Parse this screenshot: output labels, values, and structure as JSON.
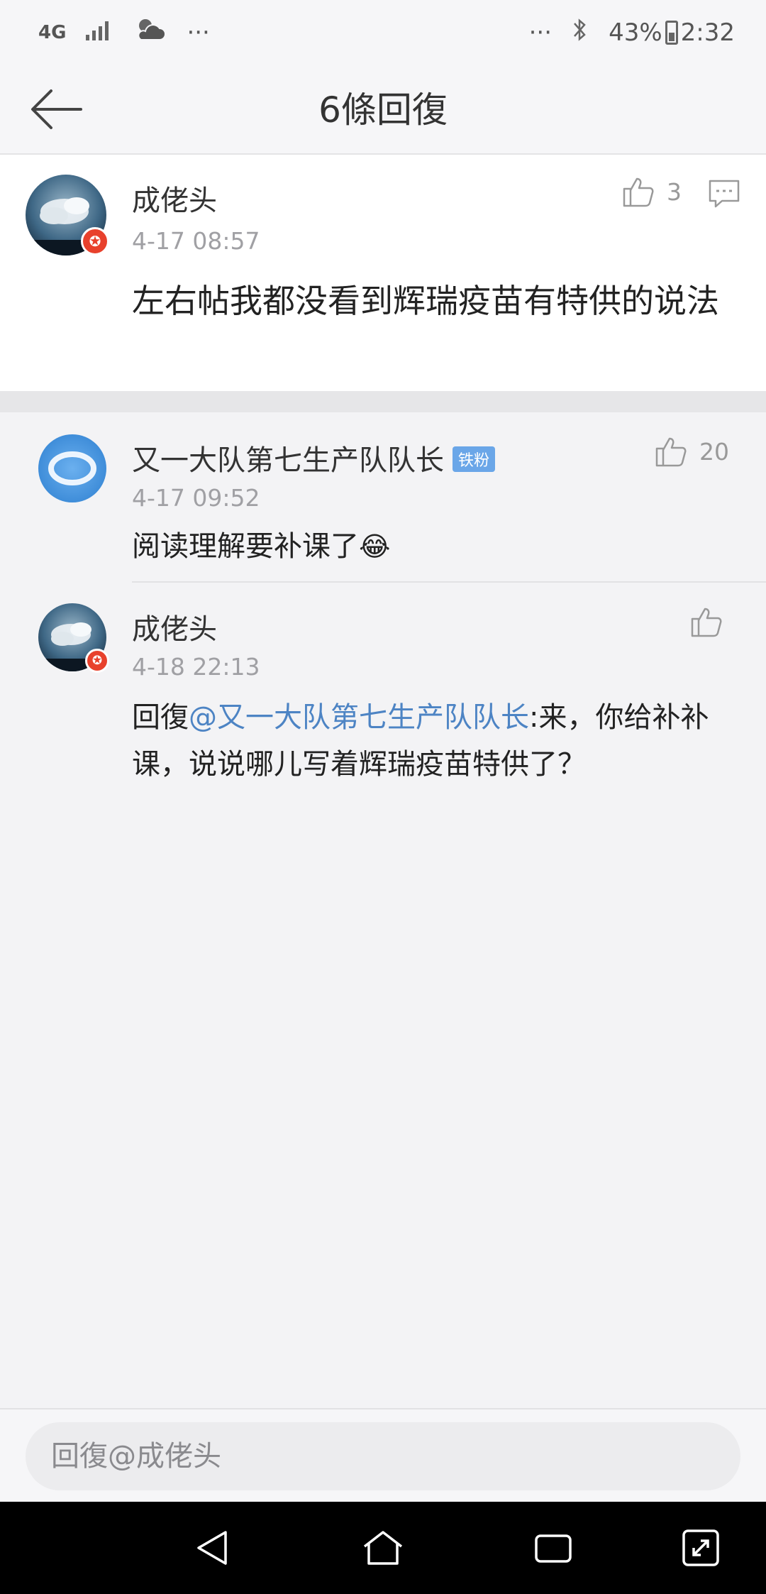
{
  "status_bar": {
    "network": "4G",
    "overflow_left": "···",
    "overflow_right": "···",
    "battery": "43%",
    "time": "2:32"
  },
  "header": {
    "title": "6條回復"
  },
  "main_post": {
    "author": "成佬头",
    "time": "4-17 08:57",
    "content": "左右帖我都没看到辉瑞疫苗有特供的说法",
    "likes": "3"
  },
  "replies": [
    {
      "author": "又一大队第七生产队队长",
      "badge": "铁粉",
      "time": "4-17 09:52",
      "content": "阅读理解要补课了",
      "emoji": "😂",
      "likes": "20"
    },
    {
      "author": "成佬头",
      "time": "4-18 22:13",
      "reply_prefix": "回復",
      "mention": "@又一大队第七生产队队长",
      "content": ":来，你给补补课，说说哪儿写着辉瑞疫苗特供了？"
    }
  ],
  "input": {
    "placeholder": "回復@成佬头"
  },
  "colors": {
    "mention": "#4d84c4",
    "badge_fans": "#6aa6e8",
    "avatar_badge": "#e8412c"
  }
}
